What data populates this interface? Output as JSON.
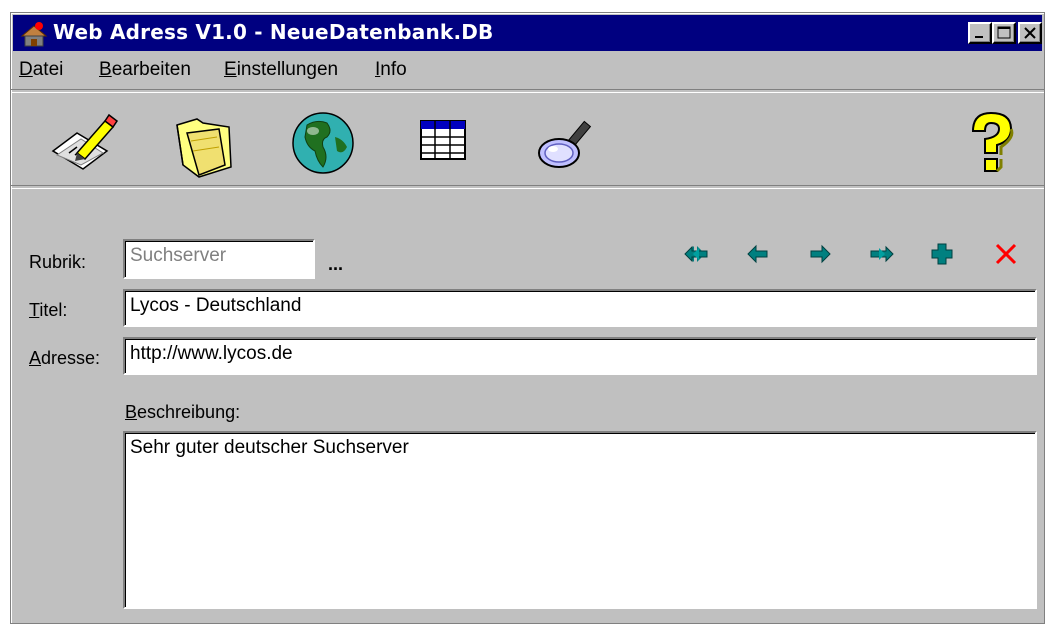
{
  "window": {
    "title": "Web Adress V1.0 - NeueDatenbank.DB",
    "minimize_label": "_",
    "maximize_label": "□",
    "close_label": "×"
  },
  "menu": [
    {
      "label_ul": "D",
      "label_rest": "atei"
    },
    {
      "label_ul": "B",
      "label_rest": "earbeiten"
    },
    {
      "label_ul": "E",
      "label_rest": "instellungen"
    },
    {
      "label_ul": "I",
      "label_rest": "nfo"
    }
  ],
  "toolbar": {
    "icons": [
      "edit-icon",
      "folder-icon",
      "globe-icon",
      "table-icon",
      "search-icon",
      "help-icon"
    ]
  },
  "form": {
    "rubrik_label": "Rubrik:",
    "rubrik_value": "Suchserver",
    "rubrik_browse": "...",
    "titel_label_ul": "T",
    "titel_label_rest": "itel:",
    "titel_value": "Lycos - Deutschland",
    "adresse_label_ul": "A",
    "adresse_label_rest": "dresse:",
    "adresse_value": "http://www.lycos.de",
    "beschreibung_label_ul": "B",
    "beschreibung_label_rest": "eschreibung:",
    "beschreibung_value": "Sehr guter deutscher Suchserver"
  },
  "navigation": {
    "icons": [
      "first-record-icon",
      "prev-record-icon",
      "next-record-icon",
      "last-record-icon",
      "add-record-icon",
      "delete-record-icon"
    ],
    "arrow_color": "#008080",
    "delete_color": "#ff0000"
  }
}
